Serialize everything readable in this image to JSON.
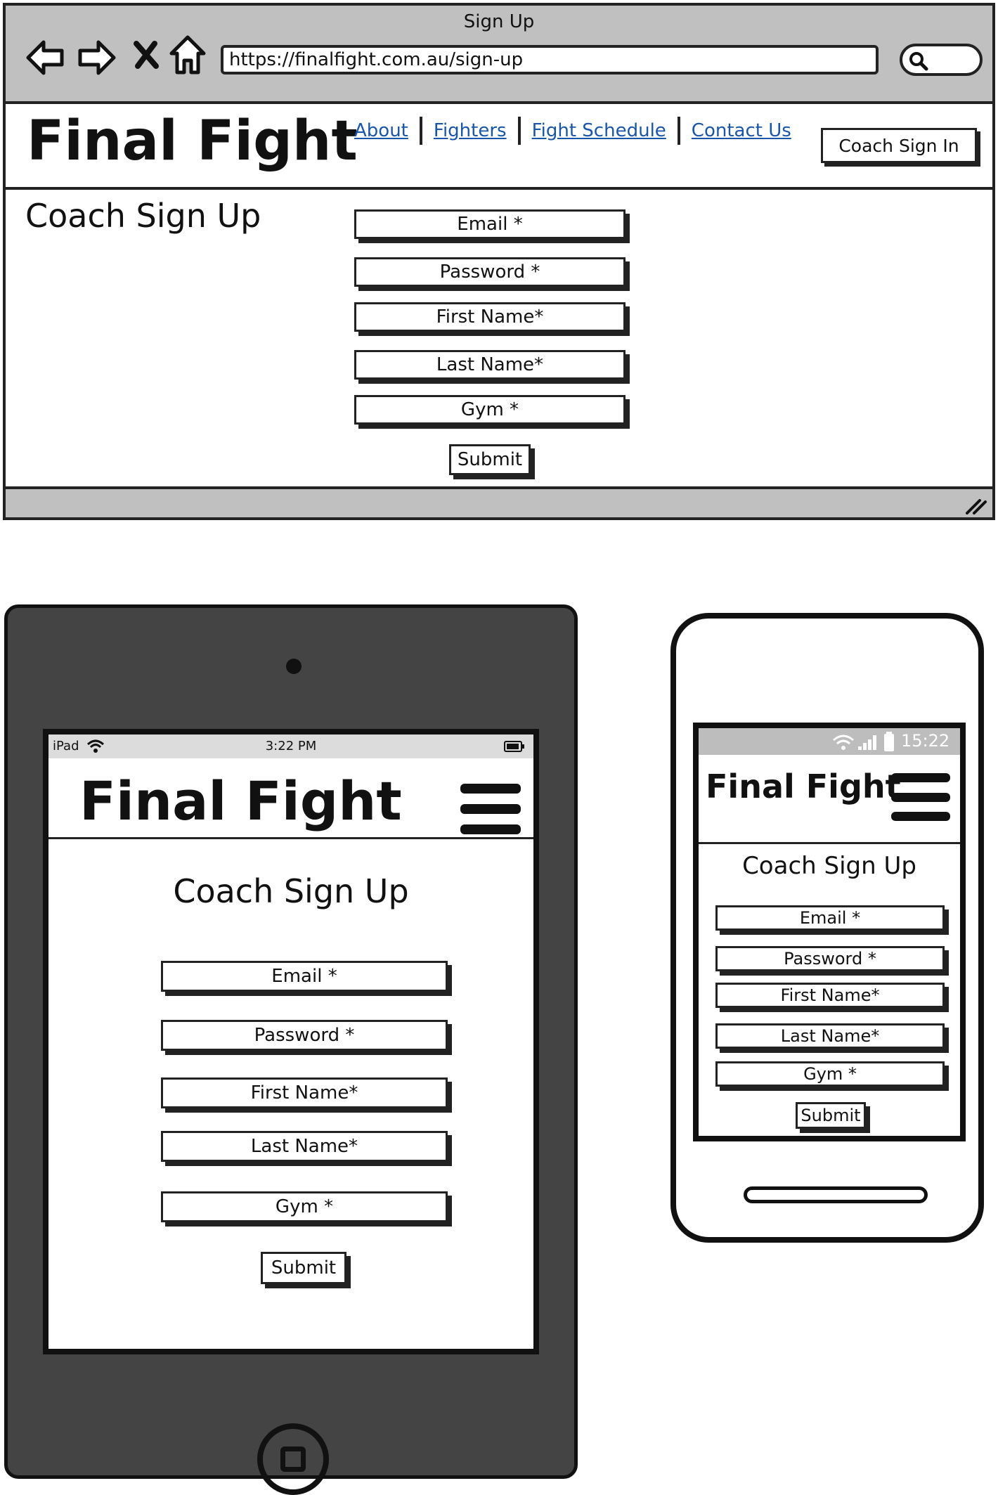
{
  "browser": {
    "window_title": "Sign Up",
    "url": "https://finalfight.com.au/sign-up",
    "site_title": "Final Fight",
    "nav": [
      {
        "label": "About"
      },
      {
        "label": "Fighters"
      },
      {
        "label": "Fight Schedule"
      },
      {
        "label": "Contact Us"
      }
    ],
    "signin_label": "Coach Sign In",
    "page_title": "Coach Sign Up",
    "fields": [
      {
        "label": "Email *"
      },
      {
        "label": "Password *"
      },
      {
        "label": "First Name*"
      },
      {
        "label": "Last Name*"
      },
      {
        "label": "Gym *"
      }
    ],
    "submit_label": "Submit"
  },
  "tablet": {
    "device": "iPad",
    "time": "3:22 PM",
    "site_title": "Final Fight",
    "page_title": "Coach Sign Up",
    "fields": [
      {
        "label": "Email *"
      },
      {
        "label": "Password *"
      },
      {
        "label": "First Name*"
      },
      {
        "label": "Last Name*"
      },
      {
        "label": "Gym *"
      }
    ],
    "submit_label": "Submit"
  },
  "phone": {
    "time": "15:22",
    "site_title": "Final Fight",
    "page_title": "Coach Sign Up",
    "fields": [
      {
        "label": "Email *"
      },
      {
        "label": "Password *"
      },
      {
        "label": "First Name*"
      },
      {
        "label": "Last Name*"
      },
      {
        "label": "Gym *"
      }
    ],
    "submit_label": "Submit"
  },
  "icons": {
    "back": "back-arrow-icon",
    "forward": "forward-arrow-icon",
    "stop": "close-icon",
    "home": "home-icon",
    "search": "search-icon",
    "menu": "hamburger-menu-icon",
    "wifi": "wifi-icon",
    "battery": "battery-icon",
    "signal": "signal-icon",
    "resize": "resize-grip-icon"
  }
}
